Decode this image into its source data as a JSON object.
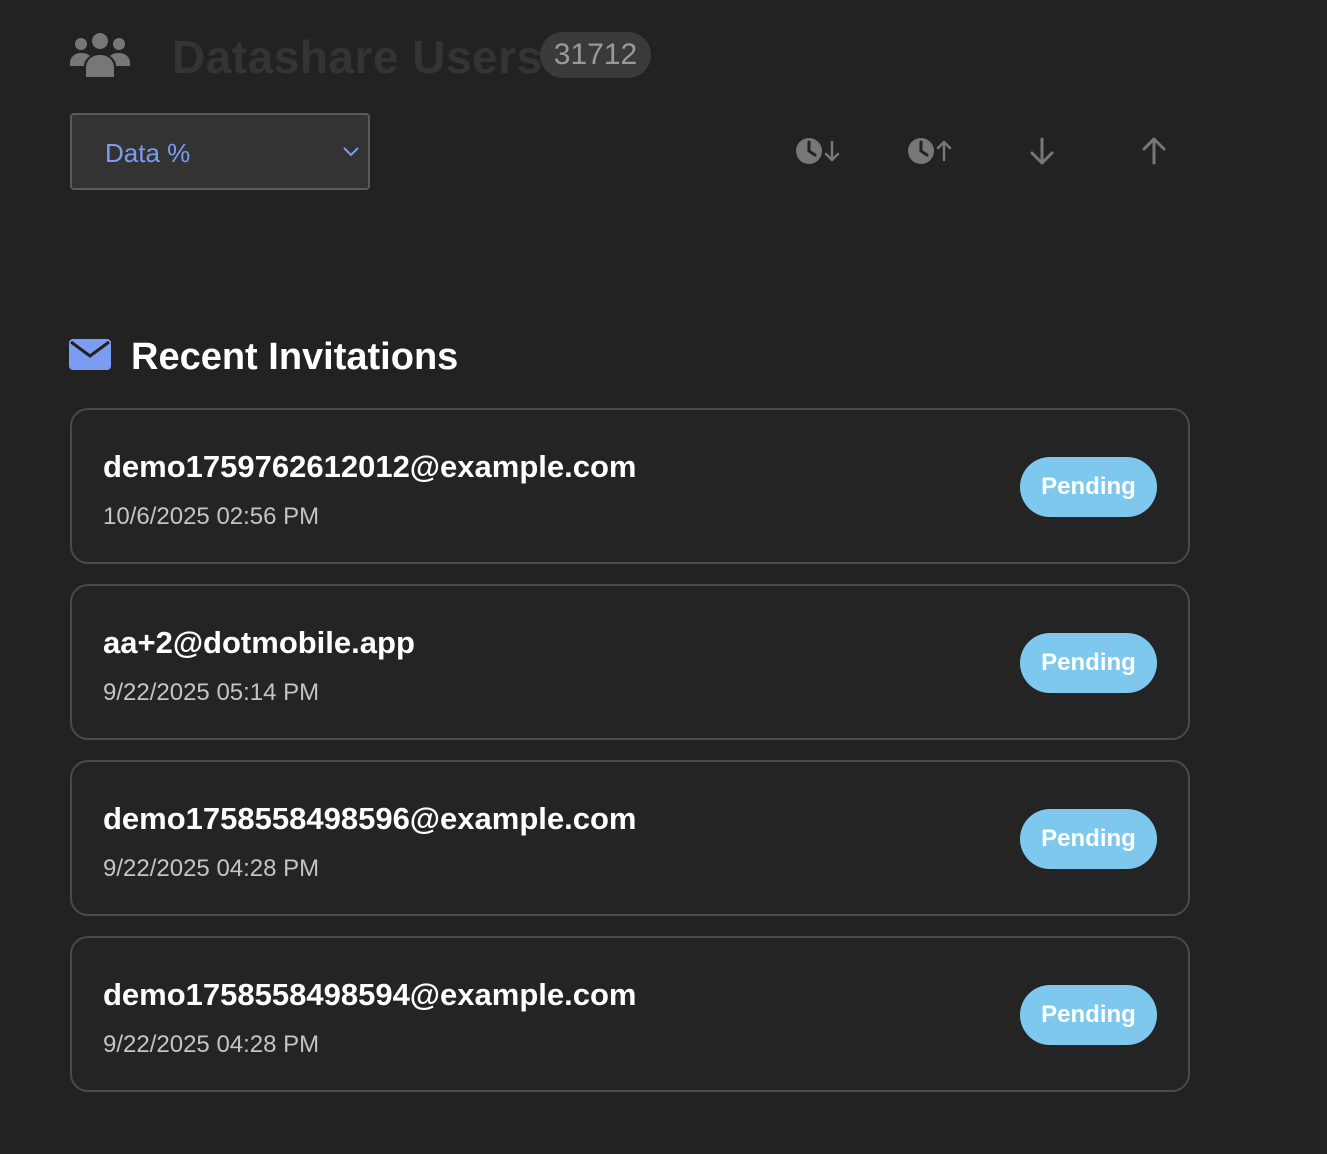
{
  "header": {
    "icon": "users-icon",
    "title": "Datashare Users",
    "count": "31712"
  },
  "controls": {
    "sort_select": {
      "value": "Data %",
      "icon": "chevron-down-icon"
    },
    "sort_buttons": [
      {
        "icon": "clock-arrow-down-icon"
      },
      {
        "icon": "clock-arrow-up-icon"
      },
      {
        "icon": "arrow-down-icon"
      },
      {
        "icon": "arrow-up-icon"
      }
    ]
  },
  "invitations": {
    "icon": "envelope-icon",
    "title": "Recent Invitations",
    "items": [
      {
        "email": "demo1759762612012@example.com",
        "date": "10/6/2025 02:56 PM",
        "status": "Pending"
      },
      {
        "email": "aa+2@dotmobile.app",
        "date": "9/22/2025 05:14 PM",
        "status": "Pending"
      },
      {
        "email": "demo1758558498596@example.com",
        "date": "9/22/2025 04:28 PM",
        "status": "Pending"
      },
      {
        "email": "demo1758558498594@example.com",
        "date": "9/22/2025 04:28 PM",
        "status": "Pending"
      }
    ]
  },
  "colors": {
    "background": "#222222",
    "accent": "#7c9cf2",
    "status_pending": "#7ec8ee",
    "muted_icon": "#777777"
  }
}
